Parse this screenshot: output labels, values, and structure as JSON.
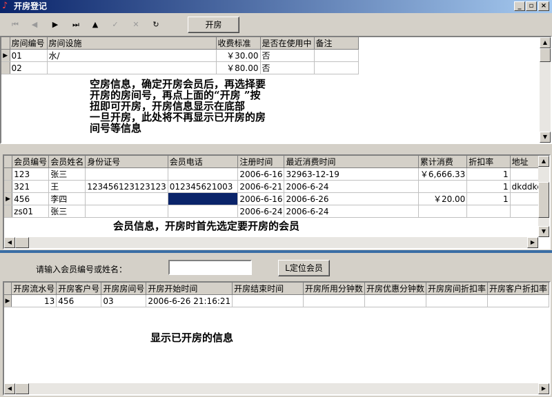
{
  "window": {
    "title": "开房登记",
    "min_label": "_",
    "max_label": "▫",
    "close_label": "×"
  },
  "toolbar": {
    "first_icon": "⏮",
    "prev_icon": "◀",
    "next_icon": "▶",
    "last_icon": "⏭",
    "up_icon": "▲",
    "check_icon": "✓",
    "cancel_icon": "✕",
    "refresh_icon": "↻",
    "open_room_label": "开房"
  },
  "rooms": {
    "columns": [
      "房间编号",
      "房间设施",
      "收费标准",
      "是否在使用中",
      "备注"
    ],
    "rows": [
      [
        "01",
        "水/",
        "￥30.00",
        "否",
        ""
      ],
      [
        "02",
        "",
        "￥80.00",
        "否",
        ""
      ]
    ],
    "note": "空房信息，确定开房会员后，再选择要\n开房的房间号，再点上面的“开房 ”按\n扭即可开房，开房信息显示在底部\n一旦开房，此处将不再显示已开房的房\n间号等信息"
  },
  "members": {
    "columns": [
      "会员编号",
      "会员姓名",
      "身份证号",
      "会员电话",
      "注册时间",
      "最近消费时间",
      "累计消费",
      "折扣率",
      "地址"
    ],
    "rows": [
      [
        "123",
        "张三",
        "",
        "",
        "2006-6-16",
        "32963-12-19",
        "￥6,666.33",
        "1",
        ""
      ],
      [
        "321",
        "王",
        "123456123123123",
        "012345621003",
        "2006-6-21",
        "2006-6-24",
        "",
        "1",
        "dkddkdk"
      ],
      [
        "456",
        "李四",
        "",
        "",
        "2006-6-16",
        "2006-6-26",
        "￥20.00",
        "1",
        ""
      ],
      [
        "zs01",
        "张三",
        "",
        "",
        "2006-6-24",
        "2006-6-24",
        "",
        "",
        ""
      ]
    ],
    "note": "会员信息，开房时首先选定要开房的会员"
  },
  "locate": {
    "label": "请输入会员编号或姓名：",
    "value": "",
    "button_label": "L定位会员"
  },
  "orders": {
    "columns": [
      "开房流水号",
      "开房客户号",
      "开房房间号",
      "开房开始时间",
      "开房结束时间",
      "开房所用分钟数",
      "开房优惠分钟数",
      "开房房间折扣率",
      "开房客户折扣率"
    ],
    "rows": [
      [
        "13",
        "456",
        "03",
        "2006-6-26 21:16:21",
        "",
        "",
        "",
        "",
        ""
      ]
    ],
    "note": "显示已开房的信息"
  },
  "colors": {
    "title_gradient_start": "#0a246a",
    "title_gradient_end": "#a6caf0",
    "selection": "#0a246a",
    "splitter": "#3a6ea5"
  }
}
